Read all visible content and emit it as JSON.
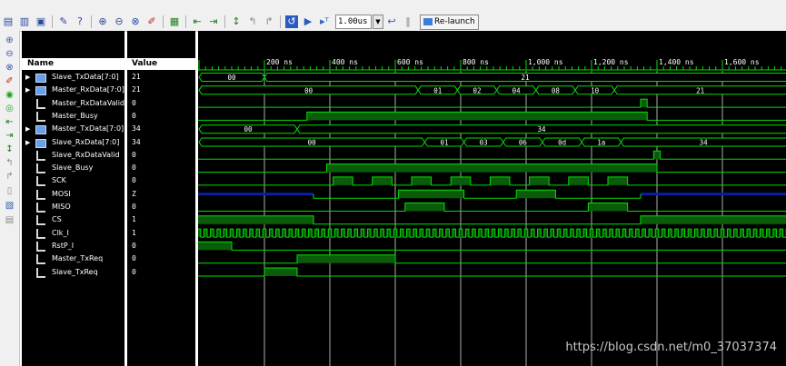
{
  "toolbar": {
    "time_value": "1.00us",
    "relaunch_label": "Re-launch",
    "icons": [
      "copy-icon",
      "paste-icon",
      "restore-icon",
      "wrench-icon",
      "help-icon",
      "zoom-in-icon",
      "zoom-out-icon",
      "zoom-fit-icon",
      "marker-icon",
      "save-wave-icon",
      "go-prev-edge-icon",
      "go-next-edge-icon",
      "cursor-icon",
      "run-back-icon",
      "step-icon",
      "restart-icon",
      "run-icon",
      "run-for-icon",
      "break-icon",
      "pause-icon"
    ]
  },
  "columns": {
    "name": "Name",
    "value": "Value"
  },
  "timeline": {
    "ticks": [
      "200 ns",
      "400 ns",
      "600 ns",
      "800 ns",
      "1,000 ns",
      "1,200 ns",
      "1,400 ns",
      "1,600 ns"
    ]
  },
  "signals": [
    {
      "name": "Slave_TxData[7:0]",
      "value": "21",
      "type": "bus",
      "expandable": true
    },
    {
      "name": "Master_RxData[7:0]",
      "value": "21",
      "type": "bus",
      "expandable": true
    },
    {
      "name": "Master_RxDataValid",
      "value": "0",
      "type": "bit",
      "expandable": false
    },
    {
      "name": "Master_Busy",
      "value": "0",
      "type": "bit",
      "expandable": false
    },
    {
      "name": "Master_TxData[7:0]",
      "value": "34",
      "type": "bus",
      "expandable": true
    },
    {
      "name": "Slave_RxData[7:0]",
      "value": "34",
      "type": "bus",
      "expandable": true
    },
    {
      "name": "Slave_RxDataValid",
      "value": "0",
      "type": "bit",
      "expandable": false
    },
    {
      "name": "Slave_Busy",
      "value": "0",
      "type": "bit",
      "expandable": false
    },
    {
      "name": "SCK",
      "value": "0",
      "type": "bit",
      "expandable": false
    },
    {
      "name": "MOSI",
      "value": "Z",
      "type": "bit",
      "expandable": false
    },
    {
      "name": "MISO",
      "value": "0",
      "type": "bit",
      "expandable": false
    },
    {
      "name": "CS",
      "value": "1",
      "type": "bit",
      "expandable": false
    },
    {
      "name": "Clk_I",
      "value": "1",
      "type": "bit",
      "expandable": false
    },
    {
      "name": "RstP_I",
      "value": "0",
      "type": "bit",
      "expandable": false
    },
    {
      "name": "Master_TxReq",
      "value": "0",
      "type": "bit",
      "expandable": false
    },
    {
      "name": "Slave_TxReq",
      "value": "0",
      "type": "bit",
      "expandable": false
    }
  ],
  "bus_labels": {
    "slave_txdata": [
      "00",
      "21"
    ],
    "master_rxdata": [
      "00",
      "01",
      "02",
      "04",
      "08",
      "10",
      "21"
    ],
    "master_txdata": [
      "00",
      "34"
    ],
    "slave_rxdata": [
      "00",
      "01",
      "03",
      "06",
      "0d",
      "1a",
      "34"
    ]
  },
  "colors": {
    "wave_green": "#00e000",
    "bus_fill": "#0a5c0a",
    "z_blue": "#0c1fa0",
    "grid": "#ffffff"
  },
  "watermark": "https://blog.csdn.net/m0_37037374"
}
